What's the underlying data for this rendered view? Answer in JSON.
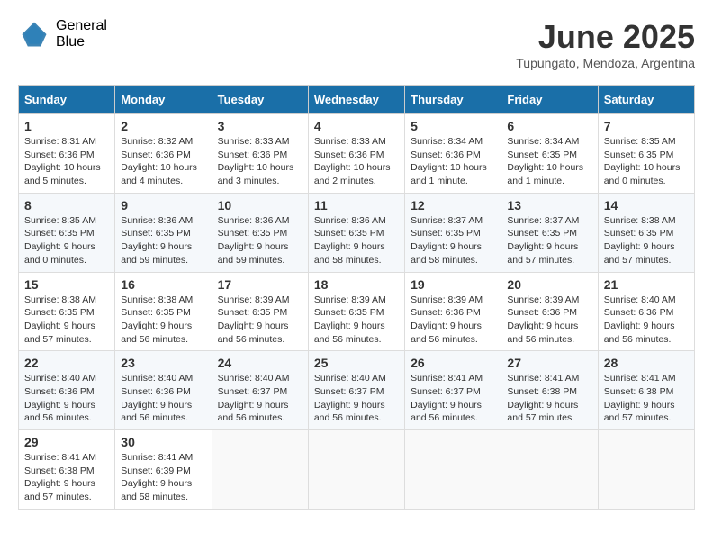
{
  "logo": {
    "general": "General",
    "blue": "Blue"
  },
  "title": "June 2025",
  "subtitle": "Tupungato, Mendoza, Argentina",
  "weekdays": [
    "Sunday",
    "Monday",
    "Tuesday",
    "Wednesday",
    "Thursday",
    "Friday",
    "Saturday"
  ],
  "weeks": [
    [
      {
        "day": "1",
        "sunrise": "8:31 AM",
        "sunset": "6:36 PM",
        "daylight": "10 hours and 5 minutes."
      },
      {
        "day": "2",
        "sunrise": "8:32 AM",
        "sunset": "6:36 PM",
        "daylight": "10 hours and 4 minutes."
      },
      {
        "day": "3",
        "sunrise": "8:33 AM",
        "sunset": "6:36 PM",
        "daylight": "10 hours and 3 minutes."
      },
      {
        "day": "4",
        "sunrise": "8:33 AM",
        "sunset": "6:36 PM",
        "daylight": "10 hours and 2 minutes."
      },
      {
        "day": "5",
        "sunrise": "8:34 AM",
        "sunset": "6:36 PM",
        "daylight": "10 hours and 1 minute."
      },
      {
        "day": "6",
        "sunrise": "8:34 AM",
        "sunset": "6:35 PM",
        "daylight": "10 hours and 1 minute."
      },
      {
        "day": "7",
        "sunrise": "8:35 AM",
        "sunset": "6:35 PM",
        "daylight": "10 hours and 0 minutes."
      }
    ],
    [
      {
        "day": "8",
        "sunrise": "8:35 AM",
        "sunset": "6:35 PM",
        "daylight": "9 hours and 0 minutes."
      },
      {
        "day": "9",
        "sunrise": "8:36 AM",
        "sunset": "6:35 PM",
        "daylight": "9 hours and 59 minutes."
      },
      {
        "day": "10",
        "sunrise": "8:36 AM",
        "sunset": "6:35 PM",
        "daylight": "9 hours and 59 minutes."
      },
      {
        "day": "11",
        "sunrise": "8:36 AM",
        "sunset": "6:35 PM",
        "daylight": "9 hours and 58 minutes."
      },
      {
        "day": "12",
        "sunrise": "8:37 AM",
        "sunset": "6:35 PM",
        "daylight": "9 hours and 58 minutes."
      },
      {
        "day": "13",
        "sunrise": "8:37 AM",
        "sunset": "6:35 PM",
        "daylight": "9 hours and 57 minutes."
      },
      {
        "day": "14",
        "sunrise": "8:38 AM",
        "sunset": "6:35 PM",
        "daylight": "9 hours and 57 minutes."
      }
    ],
    [
      {
        "day": "15",
        "sunrise": "8:38 AM",
        "sunset": "6:35 PM",
        "daylight": "9 hours and 57 minutes."
      },
      {
        "day": "16",
        "sunrise": "8:38 AM",
        "sunset": "6:35 PM",
        "daylight": "9 hours and 56 minutes."
      },
      {
        "day": "17",
        "sunrise": "8:39 AM",
        "sunset": "6:35 PM",
        "daylight": "9 hours and 56 minutes."
      },
      {
        "day": "18",
        "sunrise": "8:39 AM",
        "sunset": "6:35 PM",
        "daylight": "9 hours and 56 minutes."
      },
      {
        "day": "19",
        "sunrise": "8:39 AM",
        "sunset": "6:36 PM",
        "daylight": "9 hours and 56 minutes."
      },
      {
        "day": "20",
        "sunrise": "8:39 AM",
        "sunset": "6:36 PM",
        "daylight": "9 hours and 56 minutes."
      },
      {
        "day": "21",
        "sunrise": "8:40 AM",
        "sunset": "6:36 PM",
        "daylight": "9 hours and 56 minutes."
      }
    ],
    [
      {
        "day": "22",
        "sunrise": "8:40 AM",
        "sunset": "6:36 PM",
        "daylight": "9 hours and 56 minutes."
      },
      {
        "day": "23",
        "sunrise": "8:40 AM",
        "sunset": "6:36 PM",
        "daylight": "9 hours and 56 minutes."
      },
      {
        "day": "24",
        "sunrise": "8:40 AM",
        "sunset": "6:37 PM",
        "daylight": "9 hours and 56 minutes."
      },
      {
        "day": "25",
        "sunrise": "8:40 AM",
        "sunset": "6:37 PM",
        "daylight": "9 hours and 56 minutes."
      },
      {
        "day": "26",
        "sunrise": "8:41 AM",
        "sunset": "6:37 PM",
        "daylight": "9 hours and 56 minutes."
      },
      {
        "day": "27",
        "sunrise": "8:41 AM",
        "sunset": "6:38 PM",
        "daylight": "9 hours and 57 minutes."
      },
      {
        "day": "28",
        "sunrise": "8:41 AM",
        "sunset": "6:38 PM",
        "daylight": "9 hours and 57 minutes."
      }
    ],
    [
      {
        "day": "29",
        "sunrise": "8:41 AM",
        "sunset": "6:38 PM",
        "daylight": "9 hours and 57 minutes."
      },
      {
        "day": "30",
        "sunrise": "8:41 AM",
        "sunset": "6:39 PM",
        "daylight": "9 hours and 58 minutes."
      },
      null,
      null,
      null,
      null,
      null
    ]
  ],
  "labels": {
    "sunrise": "Sunrise:",
    "sunset": "Sunset:",
    "daylight": "Daylight:"
  }
}
